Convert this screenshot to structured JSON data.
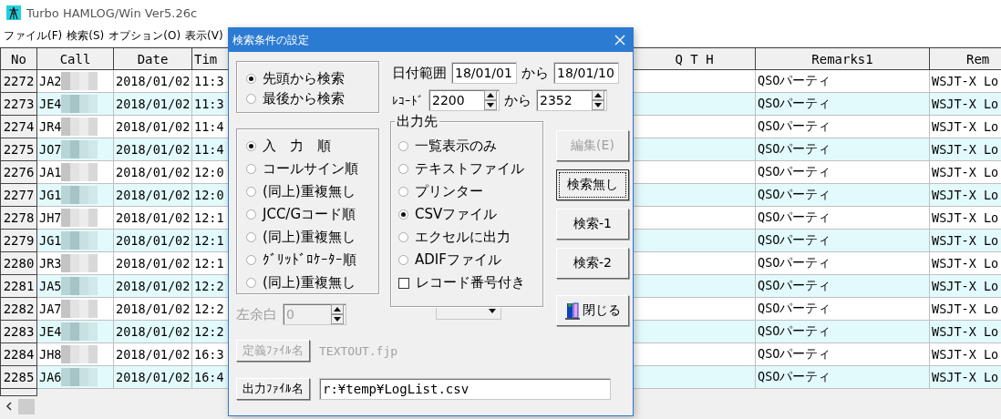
{
  "window": {
    "title": "Turbo HAMLOG/Win Ver5.26c"
  },
  "menu": [
    "ファイル(F)",
    "検索(S)",
    "オプション(O)",
    "表示(V)"
  ],
  "table": {
    "columns": [
      "No",
      "Call",
      "Date",
      "Tim",
      "Q T H",
      "Remarks1",
      "Rem"
    ],
    "rows": [
      {
        "no": "2272",
        "call": "JA2",
        "date": "2018/01/02",
        "time": "11:3",
        "remarks1": "QSOパーティ",
        "remarks2": "WSJT-X Lo"
      },
      {
        "no": "2273",
        "call": "JE4",
        "date": "2018/01/02",
        "time": "11:3",
        "remarks1": "QSOパーティ",
        "remarks2": "WSJT-X Lo"
      },
      {
        "no": "2274",
        "call": "JR4",
        "date": "2018/01/02",
        "time": "11:4",
        "remarks1": "QSOパーティ",
        "remarks2": "WSJT-X Lo"
      },
      {
        "no": "2275",
        "call": "JO7",
        "date": "2018/01/02",
        "time": "11:4",
        "remarks1": "QSOパーティ",
        "remarks2": "WSJT-X Lo"
      },
      {
        "no": "2276",
        "call": "JA1",
        "date": "2018/01/02",
        "time": "12:0",
        "remarks1": "QSOパーティ",
        "remarks2": "WSJT-X Lo"
      },
      {
        "no": "2277",
        "call": "JG1",
        "date": "2018/01/02",
        "time": "12:0",
        "remarks1": "QSOパーティ",
        "remarks2": "WSJT-X Lo"
      },
      {
        "no": "2278",
        "call": "JH7",
        "date": "2018/01/02",
        "time": "12:1",
        "remarks1": "QSOパーティ",
        "remarks2": "WSJT-X Lo"
      },
      {
        "no": "2279",
        "call": "JG1",
        "date": "2018/01/02",
        "time": "12:1",
        "remarks1": "QSOパーティ",
        "remarks2": "WSJT-X Lo"
      },
      {
        "no": "2280",
        "call": "JR3",
        "date": "2018/01/02",
        "time": "12:1",
        "remarks1": "QSOパーティ",
        "remarks2": "WSJT-X Lo"
      },
      {
        "no": "2281",
        "call": "JA5",
        "date": "2018/01/02",
        "time": "12:2",
        "remarks1": "QSOパーティ",
        "remarks2": "WSJT-X Lo"
      },
      {
        "no": "2282",
        "call": "JA7",
        "date": "2018/01/02",
        "time": "12:2",
        "remarks1": "QSOパーティ",
        "remarks2": "WSJT-X Lo"
      },
      {
        "no": "2283",
        "call": "JE4",
        "date": "2018/01/02",
        "time": "12:2",
        "remarks1": "QSOパーティ",
        "remarks2": "WSJT-X Lo"
      },
      {
        "no": "2284",
        "call": "JH8",
        "date": "2018/01/02",
        "time": "16:3",
        "remarks1": "QSOパーティ",
        "remarks2": "WSJT-X Lo"
      },
      {
        "no": "2285",
        "call": "JA6",
        "date": "2018/01/02",
        "time": "16:4",
        "remarks1": "QSOパーティ",
        "remarks2": "WSJT-X Lo"
      }
    ]
  },
  "dialog": {
    "title": "検索条件の設定",
    "direction": [
      {
        "label": "先頭から検索",
        "selected": true
      },
      {
        "label": "最後から検索",
        "selected": false
      }
    ],
    "date_range": {
      "label": "日付範囲",
      "from": "18/01/01",
      "joiner": "から",
      "to": "18/01/10"
    },
    "record_range": {
      "label": "ﾚｺｰﾄﾞ",
      "from": "2200",
      "joiner": "から",
      "to": "2352"
    },
    "sort": [
      {
        "label": "入　力　順",
        "selected": true
      },
      {
        "label": "コールサイン順",
        "selected": false
      },
      {
        "label": "(同上)重複無し",
        "selected": false
      },
      {
        "label": "JCC/Gコード順",
        "selected": false
      },
      {
        "label": "(同上)重複無し",
        "selected": false
      },
      {
        "label": "ｸﾞﾘｯﾄﾞﾛｹｰﾀｰ順",
        "selected": false
      },
      {
        "label": "(同上)重複無し",
        "selected": false
      }
    ],
    "output": {
      "legend": "出力先",
      "options": [
        {
          "label": "一覧表示のみ",
          "selected": false
        },
        {
          "label": "テキストファイル",
          "selected": false
        },
        {
          "label": "プリンター",
          "selected": false
        },
        {
          "label": "CSVファイル",
          "selected": true
        },
        {
          "label": "エクセルに出力",
          "selected": false
        },
        {
          "label": "ADIFファイル",
          "selected": false
        }
      ],
      "record_numbers": {
        "label": "レコード番号付き",
        "checked": false
      }
    },
    "buttons": [
      {
        "label": "編集(E)",
        "disabled": true,
        "focused": false
      },
      {
        "label": "検索無し",
        "disabled": false,
        "focused": true
      },
      {
        "label": "検索-1",
        "disabled": false,
        "focused": false
      },
      {
        "label": "検索-2",
        "disabled": false,
        "focused": false
      }
    ],
    "close_button": "閉じる",
    "left_margin": {
      "label": "左余白",
      "value": "0",
      "disabled": true
    },
    "definition": {
      "button": "定義ﾌｧｲﾙ名",
      "disabled": true,
      "file": "TEXTOUT.fjp"
    },
    "output_file": {
      "button": "出力ﾌｧｲﾙ名",
      "value": "r:¥temp¥LogList.csv"
    }
  }
}
